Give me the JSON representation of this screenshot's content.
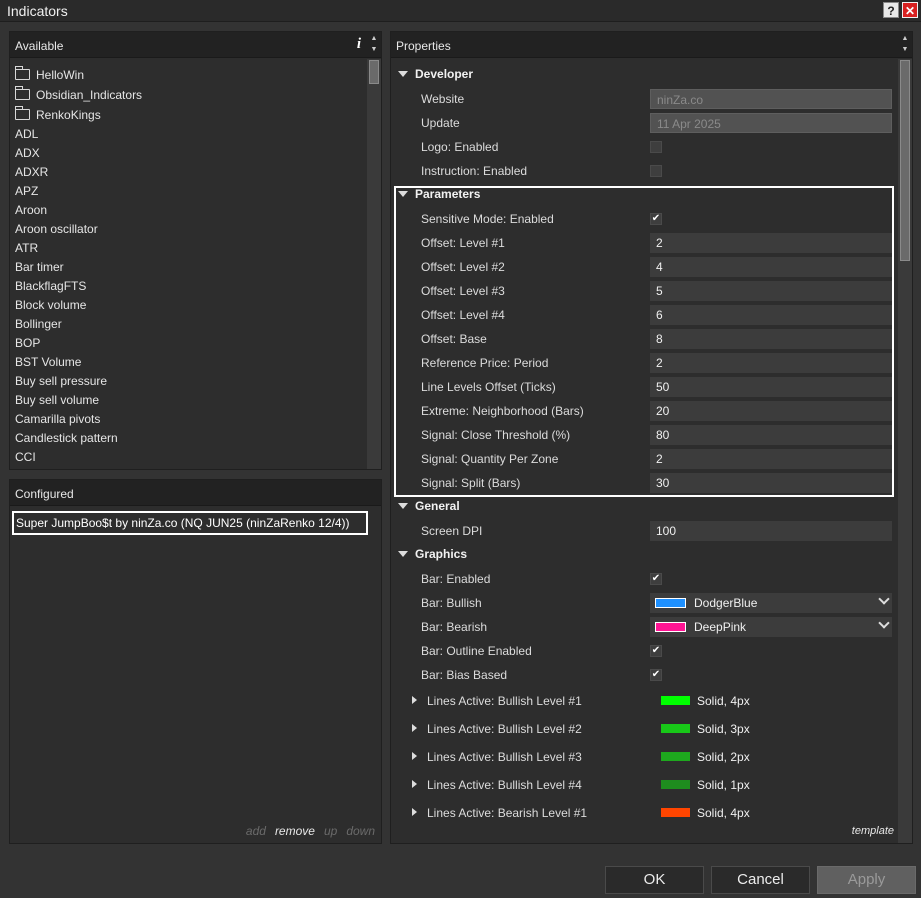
{
  "window": {
    "title": "Indicators"
  },
  "available": {
    "header": "Available",
    "info_icon": "i",
    "folders": [
      "HelloWin",
      "Obsidian_Indicators",
      "RenkoKings"
    ],
    "items": [
      "ADL",
      "ADX",
      "ADXR",
      "APZ",
      "Aroon",
      "Aroon oscillator",
      "ATR",
      "Bar timer",
      "BlackflagFTS",
      "Block volume",
      "Bollinger",
      "BOP",
      "BST Volume",
      "Buy sell pressure",
      "Buy sell volume",
      "Camarilla pivots",
      "Candlestick pattern",
      "CCI"
    ]
  },
  "configured": {
    "header": "Configured",
    "item": "Super JumpBoo$t by ninZa.co (NQ JUN25 (ninZaRenko 12/4))",
    "actions": {
      "add": "add",
      "remove": "remove",
      "up": "up",
      "down": "down"
    }
  },
  "properties": {
    "header": "Properties",
    "developer": {
      "label": "Developer",
      "website_label": "Website",
      "website_value": "ninZa.co",
      "update_label": "Update",
      "update_value": "11 Apr 2025",
      "logo_label": "Logo: Enabled",
      "logo_checked": false,
      "instruction_label": "Instruction: Enabled",
      "instruction_checked": false
    },
    "parameters": {
      "label": "Parameters",
      "rows": [
        {
          "label": "Sensitive Mode: Enabled",
          "check": true
        },
        {
          "label": "Offset: Level #1",
          "value": "2"
        },
        {
          "label": "Offset: Level #2",
          "value": "4"
        },
        {
          "label": "Offset: Level #3",
          "value": "5"
        },
        {
          "label": "Offset: Level #4",
          "value": "6"
        },
        {
          "label": "Offset: Base",
          "value": "8"
        },
        {
          "label": "Reference Price: Period",
          "value": "2"
        },
        {
          "label": "Line Levels Offset (Ticks)",
          "value": "50"
        },
        {
          "label": "Extreme: Neighborhood (Bars)",
          "value": "20"
        },
        {
          "label": "Signal: Close Threshold (%)",
          "value": "80"
        },
        {
          "label": "Signal: Quantity Per Zone",
          "value": "2"
        },
        {
          "label": "Signal: Split (Bars)",
          "value": "30"
        }
      ]
    },
    "general": {
      "label": "General",
      "dpi_label": "Screen DPI",
      "dpi_value": "100"
    },
    "graphics": {
      "label": "Graphics",
      "bar_enabled_label": "Bar: Enabled",
      "bar_bullish_label": "Bar: Bullish",
      "bar_bullish_value": "DodgerBlue",
      "bar_bullish_color": "#1e90ff",
      "bar_bearish_label": "Bar: Bearish",
      "bar_bearish_value": "DeepPink",
      "bar_bearish_color": "#ff1493",
      "outline_label": "Bar: Outline Enabled",
      "bias_label": "Bar: Bias Based",
      "lines": [
        {
          "label": "Lines Active: Bullish Level #1",
          "value": "Solid, 4px",
          "color": "#00ff00"
        },
        {
          "label": "Lines Active: Bullish Level #2",
          "value": "Solid, 3px",
          "color": "#18c818"
        },
        {
          "label": "Lines Active: Bullish Level #3",
          "value": "Solid, 2px",
          "color": "#1ea81e"
        },
        {
          "label": "Lines Active: Bullish Level #4",
          "value": "Solid, 1px",
          "color": "#1e8c1e"
        },
        {
          "label": "Lines Active: Bearish Level #1",
          "value": "Solid, 4px",
          "color": "#ff4500"
        }
      ]
    },
    "template_link": "template"
  },
  "buttons": {
    "ok": "OK",
    "cancel": "Cancel",
    "apply": "Apply"
  }
}
